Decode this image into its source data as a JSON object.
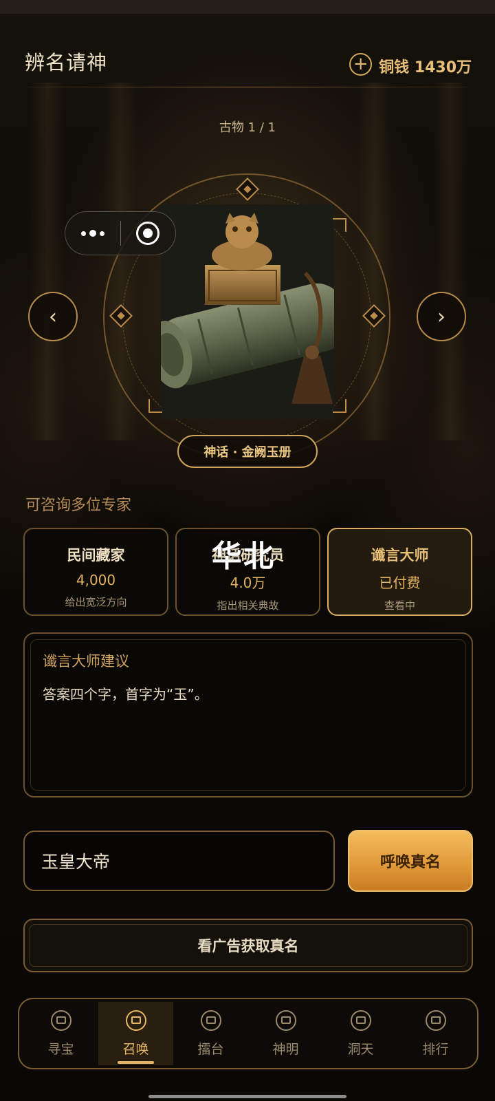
{
  "header": {
    "title": "辨名请神",
    "coins_label": "铜钱 1430万",
    "add_symbol": "+"
  },
  "carousel": {
    "counter": "古物 1 / 1",
    "prev_symbol": "‹",
    "next_symbol": "›",
    "artifact_name": "神话 · 金阙玉册"
  },
  "experts": {
    "section_label": "可咨询多位专家",
    "overlay_text": "华北",
    "items": [
      {
        "name": "民间藏家",
        "price": "4,000",
        "desc": "给出宽泛方向",
        "active": false
      },
      {
        "name": "神话研究员",
        "price": "4.0万",
        "desc": "指出相关典故",
        "active": false
      },
      {
        "name": "谶言大师",
        "price": "已付费",
        "desc": "查看中",
        "active": true
      }
    ]
  },
  "advice": {
    "title": "谶言大师建议",
    "text": "答案四个字，首字为“玉”。"
  },
  "answer": {
    "value": "玉皇大帝",
    "submit_label": "呼唤真名"
  },
  "ad_button_label": "看广告获取真名",
  "tabs": [
    {
      "label": "寻宝",
      "icon": "treasure-icon",
      "active": false
    },
    {
      "label": "召唤",
      "icon": "summon-icon",
      "active": true
    },
    {
      "label": "擂台",
      "icon": "arena-icon",
      "active": false
    },
    {
      "label": "神明",
      "icon": "deity-icon",
      "active": false
    },
    {
      "label": "洞天",
      "icon": "cave-icon",
      "active": false
    },
    {
      "label": "排行",
      "icon": "rank-icon",
      "active": false
    }
  ],
  "colors": {
    "accent_gold": "#e2b060",
    "button_orange": "#e29b3a",
    "background": "#0b0906"
  }
}
